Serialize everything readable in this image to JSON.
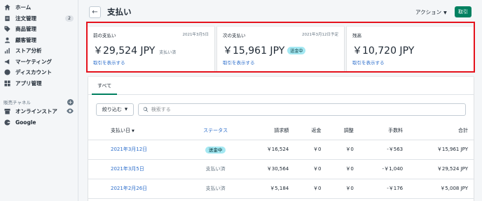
{
  "sidebar": {
    "items": [
      {
        "label": "ホーム",
        "icon": "home-icon"
      },
      {
        "label": "注文管理",
        "icon": "orders-icon",
        "badge": "2"
      },
      {
        "label": "商品管理",
        "icon": "tag-icon"
      },
      {
        "label": "顧客管理",
        "icon": "customer-icon"
      },
      {
        "label": "ストア分析",
        "icon": "analytics-icon"
      },
      {
        "label": "マーケティング",
        "icon": "marketing-icon"
      },
      {
        "label": "ディスカウント",
        "icon": "discount-icon"
      },
      {
        "label": "アプリ管理",
        "icon": "apps-icon"
      }
    ],
    "channels_heading": "販売チャネル",
    "channels": [
      {
        "label": "オンラインストア",
        "icon": "store-icon"
      },
      {
        "label": "Google",
        "icon": "google-icon"
      }
    ]
  },
  "header": {
    "title": "支払い",
    "actions_label": "アクション",
    "primary_label": "取引"
  },
  "summary_cards": [
    {
      "title": "前の支払い",
      "date": "2021年3月5日",
      "amount": "￥29,524 JPY",
      "note": "支払い済",
      "link": "取引を表示する"
    },
    {
      "title": "次の支払い",
      "date": "2021年3月12日予定",
      "amount": "￥15,961 JPY",
      "badge": "送金中",
      "link": "取引を表示する"
    },
    {
      "title": "残高",
      "date": "",
      "amount": "￥10,720 JPY",
      "link": "取引を表示する"
    }
  ],
  "panel": {
    "tab_all": "すべて",
    "filter_label": "絞り込む",
    "search_placeholder": "検索する"
  },
  "table": {
    "headers": {
      "date": "支払い日",
      "status": "ステータス",
      "amount": "請求額",
      "refund": "返金",
      "adjust": "調整",
      "fee": "手数料",
      "total": "合計"
    },
    "rows": [
      {
        "date": "2021年3月12日",
        "status": "送金中",
        "amount": "￥16,524",
        "refund": "￥0",
        "adjust": "￥0",
        "fee": "-￥563",
        "total": "￥15,961 JPY"
      },
      {
        "date": "2021年3月5日",
        "status": "支払い済",
        "amount": "￥30,564",
        "refund": "￥0",
        "adjust": "￥0",
        "fee": "-￥1,040",
        "total": "￥29,524 JPY"
      },
      {
        "date": "2021年2月26日",
        "status": "支払い済",
        "amount": "￥5,184",
        "refund": "￥0",
        "adjust": "￥0",
        "fee": "-￥176",
        "total": "￥5,008 JPY"
      }
    ]
  },
  "colors": {
    "accent": "#008060",
    "link": "#2c6ecb",
    "highlight": "#e5131d",
    "badge": "#a4e8f2"
  }
}
